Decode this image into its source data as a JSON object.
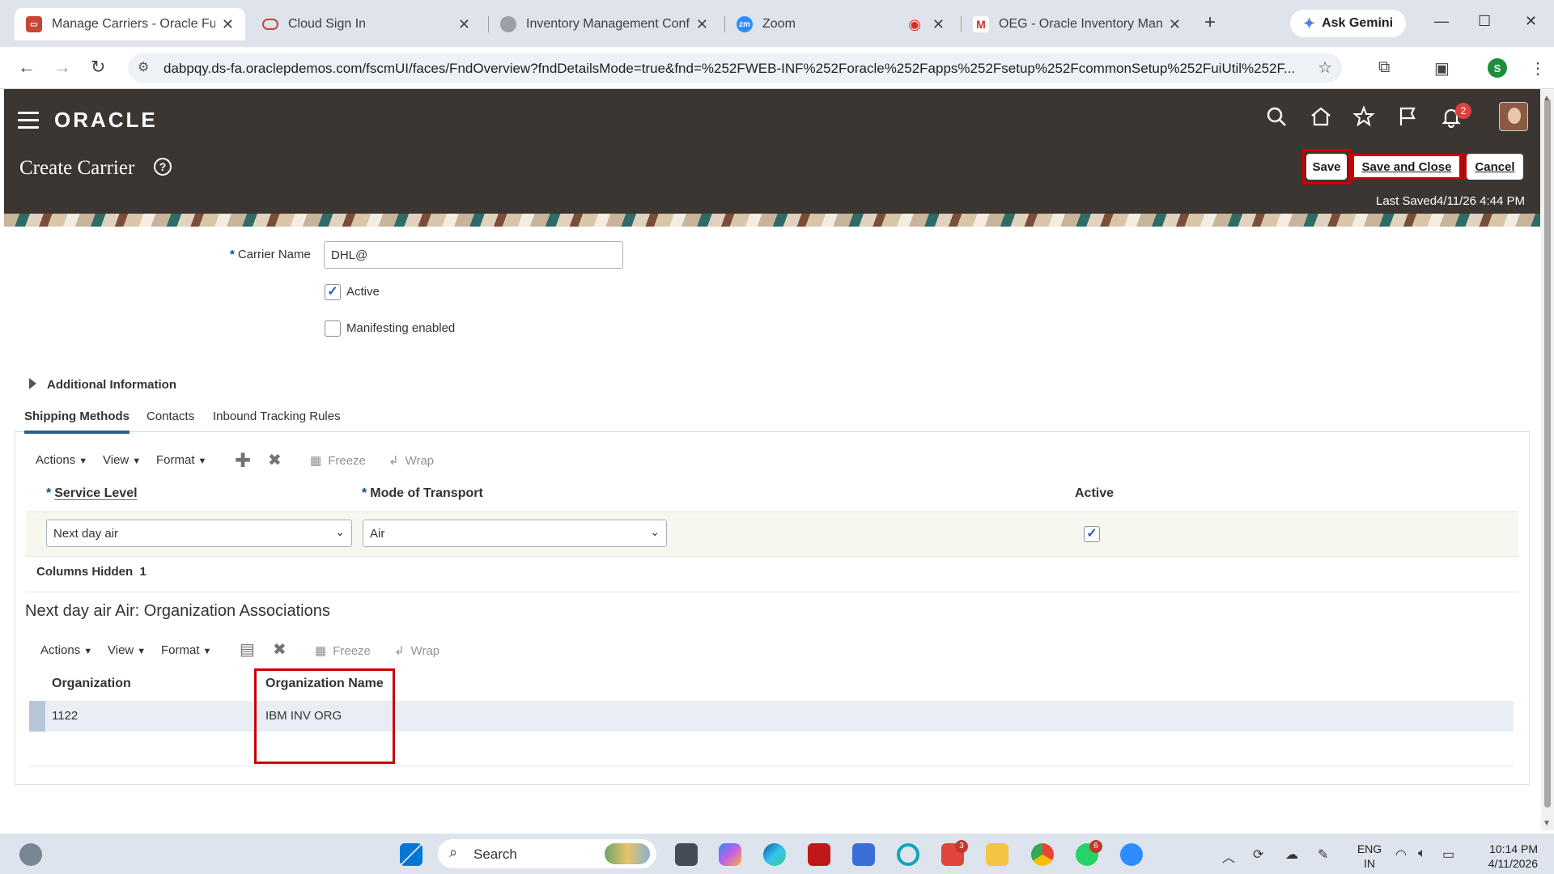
{
  "browser": {
    "tabs": [
      {
        "title": "Manage Carriers - Oracle Fusic",
        "active": true
      },
      {
        "title": "Cloud Sign In",
        "active": false
      },
      {
        "title": "Inventory Management Config",
        "active": false
      },
      {
        "title": "Zoom",
        "active": false
      },
      {
        "title": "OEG - Oracle Inventory Manag",
        "active": false
      }
    ],
    "new_tab": "+",
    "gemini_label": "Ask Gemini",
    "url": "dabpqy.ds-fa.oraclepdemos.com/fscmUI/faces/FndOverview?fndDetailsMode=true&fnd=%252FWEB-INF%252Foracle%252Fapps%252Fsetup%252FcommonSetup%252FuiUtil%252F...",
    "profile_initial": "S"
  },
  "app": {
    "logo": "ORACLE",
    "notification_count": "2",
    "page_title": "Create Carrier",
    "help_symbol": "?",
    "buttons": {
      "save": "Save",
      "save_close": "Save and Close",
      "cancel": "Cancel"
    },
    "last_saved": "Last Saved4/11/26 4:44 PM"
  },
  "form": {
    "required_mark": "*",
    "carrier_name_label": "Carrier Name",
    "carrier_name_value": "DHL@",
    "active_label": "Active",
    "active_checked": true,
    "manifesting_label": "Manifesting enabled",
    "manifesting_checked": false,
    "additional_info": "Additional Information"
  },
  "tabs": [
    "Shipping Methods",
    "Contacts",
    "Inbound Tracking Rules"
  ],
  "shipping_methods": {
    "toolbar": {
      "actions": "Actions",
      "view": "View",
      "format": "Format",
      "freeze": "Freeze",
      "wrap": "Wrap"
    },
    "columns": {
      "service_level": "Service Level",
      "mode_of_transport": "Mode of Transport",
      "active": "Active"
    },
    "row": {
      "service_level": "Next day air",
      "mode_of_transport": "Air",
      "active": true
    },
    "columns_hidden_label": "Columns Hidden",
    "columns_hidden_count": "1"
  },
  "org_assoc": {
    "title": "Next day air Air: Organization Associations",
    "toolbar": {
      "actions": "Actions",
      "view": "View",
      "format": "Format",
      "freeze": "Freeze",
      "wrap": "Wrap"
    },
    "columns": {
      "organization": "Organization",
      "organization_name": "Organization Name"
    },
    "rows": [
      {
        "organization": "1122",
        "organization_name": "IBM INV ORG"
      }
    ]
  },
  "taskbar": {
    "search": "Search",
    "badges": {
      "l_app": "3",
      "whatsapp": "6"
    },
    "lang": "ENG",
    "region": "IN",
    "time": "10:14 PM",
    "date": "4/11/2026"
  },
  "colors": {
    "oracle_header": "#3c3633",
    "highlight_red": "#cc0000",
    "tab_underline": "#2a5e8c",
    "row_highlight": "#e9eef5"
  }
}
